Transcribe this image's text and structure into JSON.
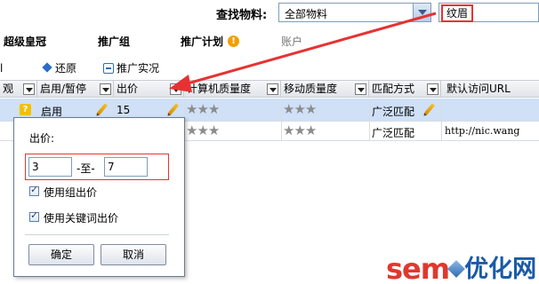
{
  "search": {
    "label": "查找物料:",
    "material_value": "全部物料",
    "keyword_value": "纹眉"
  },
  "nav": {
    "items": [
      {
        "label": "超级皇冠"
      },
      {
        "label": "推广组"
      },
      {
        "label": "推广计划"
      },
      {
        "label": "账户"
      }
    ],
    "help_label": "!"
  },
  "toolbar": {
    "left_fragment": "l",
    "restore_label": "还原",
    "promo_label": "推广实况"
  },
  "table": {
    "columns": [
      {
        "label": "观"
      },
      {
        "label": "启用/暂停"
      },
      {
        "label": "出价"
      },
      {
        "label": "计算机质量度"
      },
      {
        "label": "移动质量度"
      },
      {
        "label": "匹配方式"
      },
      {
        "label": "默认访问URL"
      }
    ],
    "rows": [
      {
        "status_icon": "?",
        "status": "启用",
        "bid": "15",
        "pc_quality": "★★★",
        "mobile_quality": "★★★",
        "match": "广泛匹配",
        "url": ""
      },
      {
        "pc_quality": "★★★",
        "mobile_quality": "★★★",
        "match": "广泛匹配",
        "url": "http://nic.wang"
      }
    ]
  },
  "popup": {
    "title": "出价:",
    "min_value": "3",
    "range_separator": "-至-",
    "max_value": "7",
    "use_group_bid_label": "使用组出价",
    "use_keyword_bid_label": "使用关键词出价",
    "ok_label": "确定",
    "cancel_label": "取消"
  },
  "watermark": {
    "sem": "sem",
    "cn": "优化网"
  },
  "colors": {
    "highlight": "#e53333",
    "selected_row": "#cfe0f7",
    "link_blue": "#2a6cc8"
  }
}
